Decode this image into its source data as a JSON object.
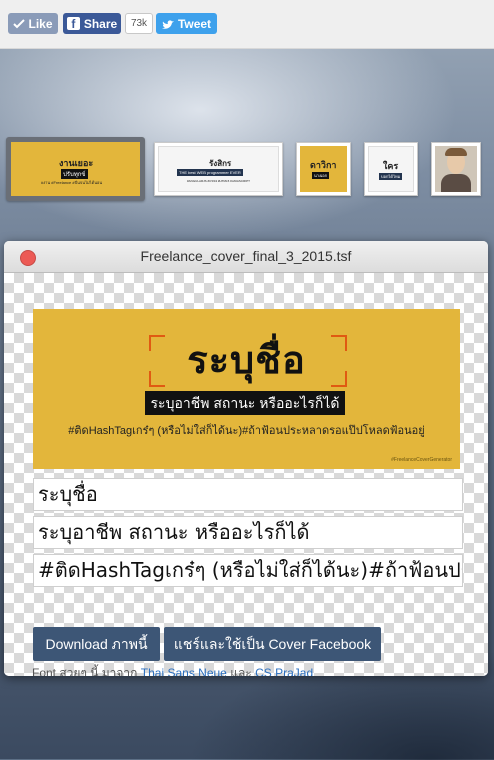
{
  "share_bar": {
    "like_label": "Like",
    "share_label": "Share",
    "share_count": "73k",
    "tweet_label": "Tweet"
  },
  "thumbnails": [
    {
      "line1": "งานเยอะ",
      "line2": "ปรับทุกข์",
      "line3": "#งาน #Freelance #ปั่นจนไม่ได้นอน",
      "selected": true
    },
    {
      "line1": "รังสิกร",
      "line2": "THE best WEB programmer EVER",
      "line3": "#ANGULARJS #CSS3 #HTML5 #JAVASCRIPT"
    },
    {
      "line1": "ดาวิกา",
      "line2": "นางเอก"
    },
    {
      "line1": "ใคร",
      "line2": "บอกได้ไหม"
    },
    {
      "line1": ""
    }
  ],
  "window": {
    "title": "Freelance_cover_final_3_2015.tsf"
  },
  "cover": {
    "name": "ระบุชื่อ",
    "job": "ระบุอาชีพ สถานะ หรืออะไรก็ได้",
    "tags": "#ติดHashTagเกร๋ๆ (หรือไม่ใส่ก็ได้นะ)#ถ้าฟ้อนประหลาดรอแป๊ปโหลดฟ้อนอยู่",
    "credit": "#FreelanceCoverGenerator"
  },
  "inputs": {
    "name_value": "ระบุชื่อ",
    "job_value": "ระบุอาชีพ สถานะ หรืออะไรก็ได้",
    "tags_value": "#ติดHashTagเกร๋ๆ (หรือไม่ใส่ก็ได้นะ)#ถ้าฟ้อนประหลาดรอแป๊ปโหลดฟ้อนอยู่"
  },
  "actions": {
    "download_label": "Download ภาพนี้",
    "share_label": "แชร์และใช้เป็น Cover Facebook"
  },
  "credits": {
    "prefix": "Font สวยๆ นี้ มาจาก",
    "font1": "Thai Sans Neue",
    "and": "และ",
    "font2": "CS PraJad"
  },
  "colors": {
    "facebook": "#3b5998",
    "twitter": "#3ea1ec",
    "cover_yellow": "#e3b63b",
    "button": "#3d5676",
    "close": "#ec5a55"
  }
}
